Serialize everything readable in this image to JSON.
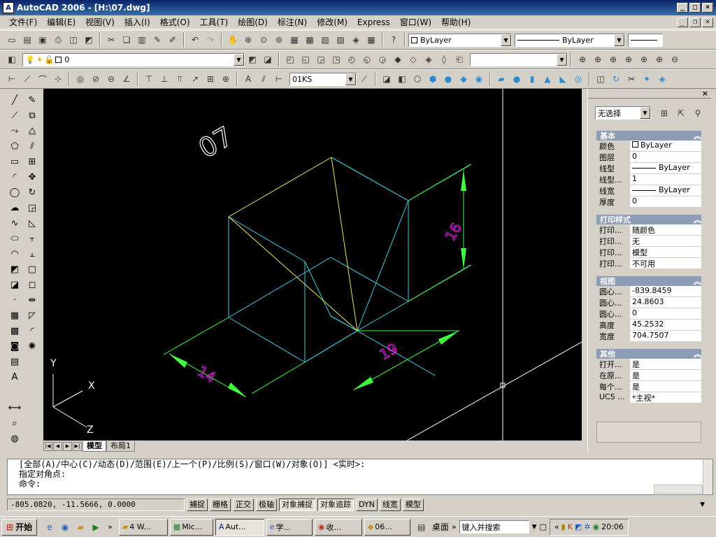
{
  "title": "AutoCAD 2006 - [H:\\07.dwg]",
  "menu": [
    "文件(F)",
    "编辑(E)",
    "视图(V)",
    "插入(I)",
    "格式(O)",
    "工具(T)",
    "绘图(D)",
    "标注(N)",
    "修改(M)",
    "Express",
    "窗口(W)",
    "帮助(H)"
  ],
  "toolbar1": {
    "color_combo": "ByLayer",
    "linetype_combo": "ByLayer"
  },
  "toolbar2": {
    "layer_combo": "0"
  },
  "toolbar3": {
    "dimstyle_combo": "01KS"
  },
  "drawing": {
    "label": "07",
    "dim_height": "16",
    "dim_right": "19",
    "dim_left": "14",
    "ucs_x": "X",
    "ucs_y": "Y",
    "ucs_z": "Z"
  },
  "tabs": [
    "模型",
    "布局1"
  ],
  "properties": {
    "selection": "无选择",
    "sections": [
      {
        "title": "基本",
        "rows": [
          [
            "颜色",
            "ByLayer"
          ],
          [
            "图层",
            "0"
          ],
          [
            "线型",
            "ByLayer"
          ],
          [
            "线型...",
            "1"
          ],
          [
            "线宽",
            "ByLayer"
          ],
          [
            "厚度",
            "0"
          ]
        ]
      },
      {
        "title": "打印样式",
        "rows": [
          [
            "打印...",
            "随颜色"
          ],
          [
            "打印...",
            "无"
          ],
          [
            "打印...",
            "模型"
          ],
          [
            "打印...",
            "不可用"
          ]
        ]
      },
      {
        "title": "视图",
        "rows": [
          [
            "圆心...",
            "-839.8459"
          ],
          [
            "圆心...",
            "24.8603"
          ],
          [
            "圆心...",
            "0"
          ],
          [
            "高度",
            "45.2532"
          ],
          [
            "宽度",
            "704.7507"
          ]
        ]
      },
      {
        "title": "其他",
        "rows": [
          [
            "打开...",
            "是"
          ],
          [
            "在原...",
            "是"
          ],
          [
            "每个...",
            "是"
          ],
          [
            "UCS ...",
            "*主视*"
          ]
        ]
      }
    ]
  },
  "command": {
    "line1": "[全部(A)/中心(C)/动态(D)/范围(E)/上一个(P)/比例(S)/窗口(W)/对象(O)] <实时>:",
    "line2": "指定对角点:",
    "prompt": "命令:"
  },
  "status": {
    "coords": "-805.0820, -11.5666, 0.0000",
    "buttons": [
      "捕捉",
      "栅格",
      "正交",
      "极轴",
      "对象捕捉",
      "对象追踪",
      "DYN",
      "线宽",
      "模型"
    ]
  },
  "taskbar": {
    "start": "开始",
    "tasks": [
      "4 W...",
      "Mic...",
      "Aut...",
      "学...",
      "收...",
      "06..."
    ],
    "desktop": "桌面",
    "search_placeholder": "键入并搜索",
    "clock": "20:06"
  },
  "colors": {
    "model_cyan": "#40d0e0",
    "model_yellow": "#e8e860",
    "dim_green": "#40ff40",
    "dim_text": "#e020e0"
  }
}
